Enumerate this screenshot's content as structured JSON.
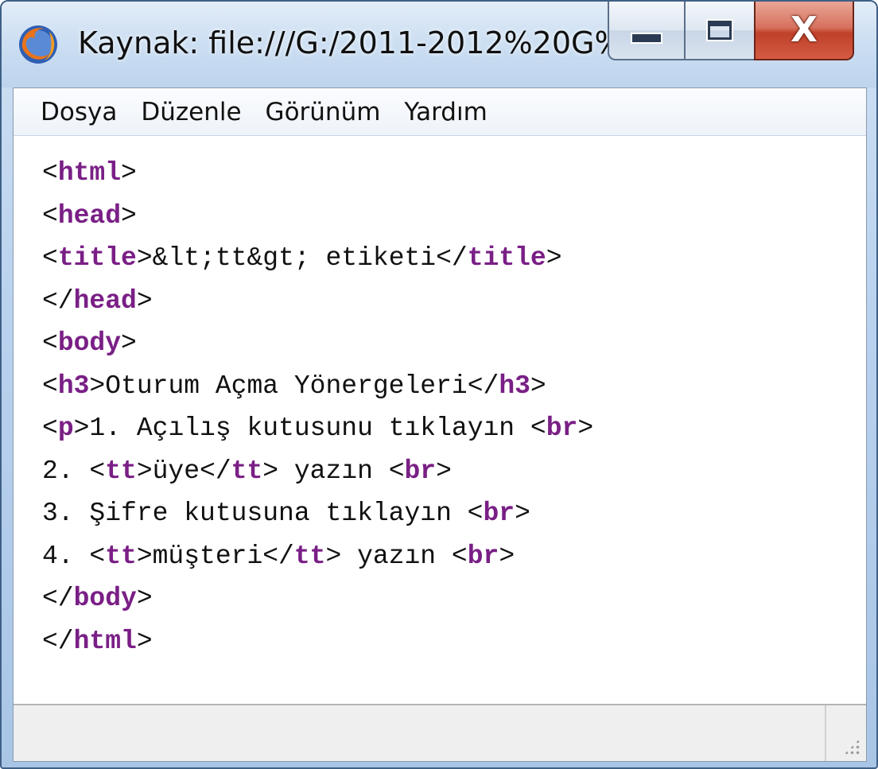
{
  "window": {
    "title": "Kaynak: file:///G:/2011-2012%20G%...",
    "close_glyph": "X",
    "icon": "firefox-icon"
  },
  "menu": {
    "items": [
      {
        "label": "Dosya"
      },
      {
        "label": "Düzenle"
      },
      {
        "label": "Görünüm"
      },
      {
        "label": "Yardım"
      }
    ]
  },
  "source": {
    "lines": [
      [
        {
          "t": "<",
          "k": "plain"
        },
        {
          "t": "html",
          "k": "tag"
        },
        {
          "t": ">",
          "k": "plain"
        }
      ],
      [
        {
          "t": "<",
          "k": "plain"
        },
        {
          "t": "head",
          "k": "tag"
        },
        {
          "t": ">",
          "k": "plain"
        }
      ],
      [
        {
          "t": "<",
          "k": "plain"
        },
        {
          "t": "title",
          "k": "tag"
        },
        {
          "t": ">&lt;tt&gt; etiketi</",
          "k": "plain"
        },
        {
          "t": "title",
          "k": "tag"
        },
        {
          "t": ">",
          "k": "plain"
        }
      ],
      [
        {
          "t": "</",
          "k": "plain"
        },
        {
          "t": "head",
          "k": "tag"
        },
        {
          "t": ">",
          "k": "plain"
        }
      ],
      [
        {
          "t": "<",
          "k": "plain"
        },
        {
          "t": "body",
          "k": "tag"
        },
        {
          "t": ">",
          "k": "plain"
        }
      ],
      [
        {
          "t": "<",
          "k": "plain"
        },
        {
          "t": "h3",
          "k": "tag"
        },
        {
          "t": ">Oturum Açma Yönergeleri</",
          "k": "plain"
        },
        {
          "t": "h3",
          "k": "tag"
        },
        {
          "t": ">",
          "k": "plain"
        }
      ],
      [
        {
          "t": "<",
          "k": "plain"
        },
        {
          "t": "p",
          "k": "tag"
        },
        {
          "t": ">1. Açılış kutusunu tıklayın <",
          "k": "plain"
        },
        {
          "t": "br",
          "k": "tag"
        },
        {
          "t": ">",
          "k": "plain"
        }
      ],
      [
        {
          "t": "2. <",
          "k": "plain"
        },
        {
          "t": "tt",
          "k": "tag"
        },
        {
          "t": ">üye</",
          "k": "plain"
        },
        {
          "t": "tt",
          "k": "tag"
        },
        {
          "t": "> yazın <",
          "k": "plain"
        },
        {
          "t": "br",
          "k": "tag"
        },
        {
          "t": ">",
          "k": "plain"
        }
      ],
      [
        {
          "t": "3. Şifre kutusuna tıklayın <",
          "k": "plain"
        },
        {
          "t": "br",
          "k": "tag"
        },
        {
          "t": ">",
          "k": "plain"
        }
      ],
      [
        {
          "t": "4. <",
          "k": "plain"
        },
        {
          "t": "tt",
          "k": "tag"
        },
        {
          "t": ">müşteri</",
          "k": "plain"
        },
        {
          "t": "tt",
          "k": "tag"
        },
        {
          "t": "> yazın <",
          "k": "plain"
        },
        {
          "t": "br",
          "k": "tag"
        },
        {
          "t": ">",
          "k": "plain"
        }
      ],
      [
        {
          "t": "</",
          "k": "plain"
        },
        {
          "t": "body",
          "k": "tag"
        },
        {
          "t": ">",
          "k": "plain"
        }
      ],
      [
        {
          "t": "</",
          "k": "plain"
        },
        {
          "t": "html",
          "k": "tag"
        },
        {
          "t": ">",
          "k": "plain"
        }
      ]
    ]
  },
  "colors": {
    "tag": "#7a1f86",
    "text": "#111111",
    "close_button": "#c0402a"
  }
}
